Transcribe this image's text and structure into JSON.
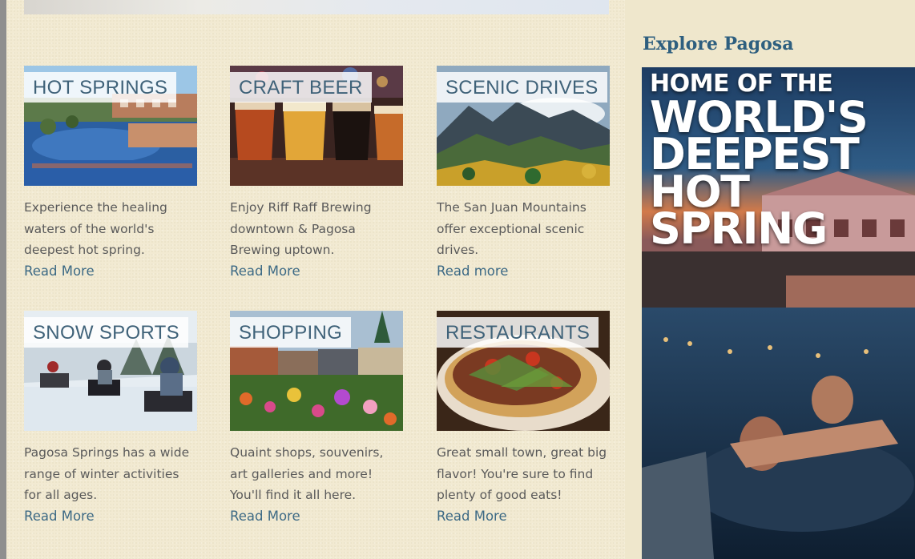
{
  "cards": [
    {
      "title": "HOT SPRINGS",
      "description": "Experience the healing waters of the world's deepest hot spring.",
      "link": "Read More"
    },
    {
      "title": "CRAFT BEER",
      "description": "Enjoy Riff Raff Brewing downtown & Pagosa Brewing uptown.",
      "link": "Read More"
    },
    {
      "title": "SCENIC DRIVES",
      "description": "The San Juan Mountains offer exceptional scenic drives.",
      "link": "Read more"
    },
    {
      "title": "SNOW SPORTS",
      "description": "Pagosa Springs has a wide range of winter activities for all ages.",
      "link": "Read More"
    },
    {
      "title": "SHOPPING",
      "description": "Quaint shops, souvenirs, art galleries and more! You'll find it all here.",
      "link": "Read More"
    },
    {
      "title": "RESTAURANTS",
      "description": "Great small town, great big flavor! You're sure to find plenty of good eats!",
      "link": "Read More"
    }
  ],
  "sidebar": {
    "title": "Explore Pagosa",
    "ad": {
      "line1": "HOME OF THE",
      "line2": "WORLD'S",
      "line3": "DEEPEST",
      "line4": "HOT",
      "line5": "SPRING"
    }
  },
  "colors": {
    "label_text": "#3f6279",
    "link": "#3d6a85",
    "heading": "#2e5f7f",
    "background": "#f2ead2"
  }
}
